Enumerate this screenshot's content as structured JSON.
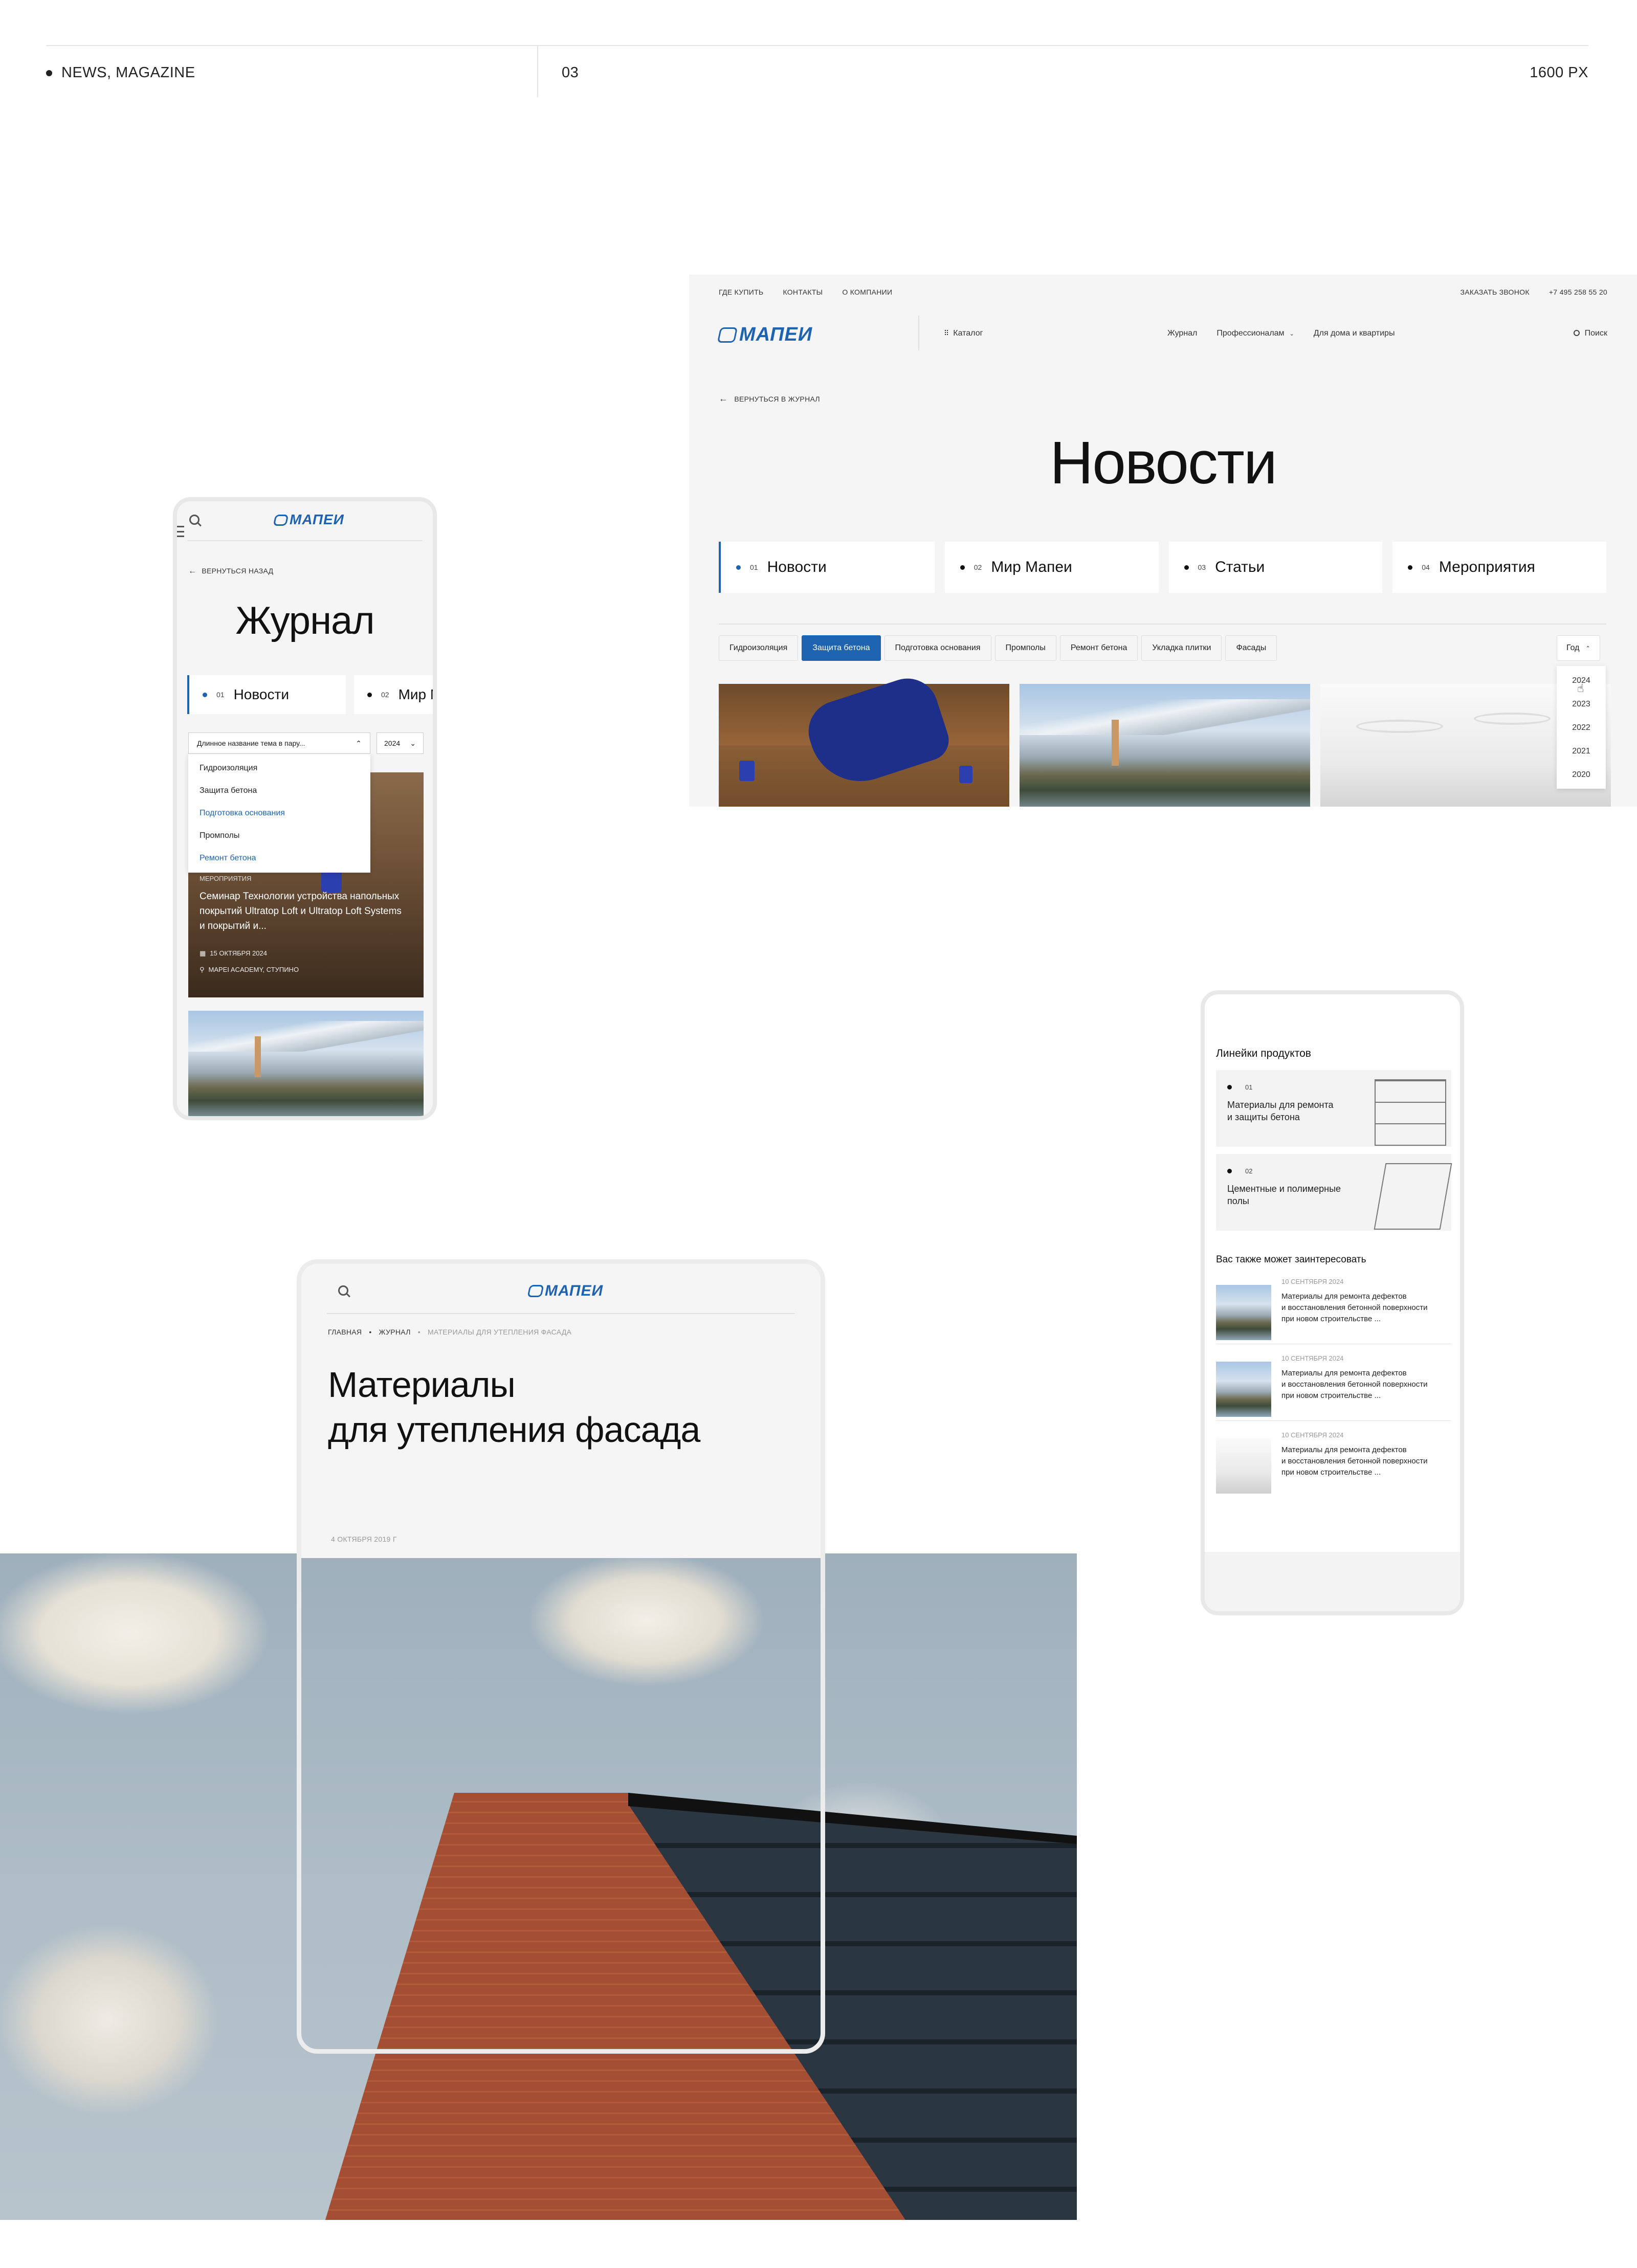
{
  "header": {
    "category": "NEWS, MAGAZINE",
    "page_no": "03",
    "width_label": "1600 PX"
  },
  "brand": {
    "logo": "МАПЕИ",
    "accent": "#1e63b0"
  },
  "desktop": {
    "utility_left": [
      "ГДЕ КУПИТЬ",
      "КОНТАКТЫ",
      "О КОМПАНИИ"
    ],
    "utility_right": [
      "ЗАКАЗАТЬ ЗВОНОК",
      "+7 495 258 55 20"
    ],
    "catalog": "Каталог",
    "nav": [
      "Журнал",
      "Профессионалам",
      "Для дома и квартиры"
    ],
    "search": "Поиск",
    "back": "ВЕРНУТЬСЯ В ЖУРНАЛ",
    "title": "Новости",
    "tabs": [
      {
        "num": "01",
        "label": "Новости"
      },
      {
        "num": "02",
        "label": "Мир Мапеи"
      },
      {
        "num": "03",
        "label": "Статьи"
      },
      {
        "num": "04",
        "label": "Мероприятия"
      }
    ],
    "chips": [
      "Гидроизоляция",
      "Защита бетона",
      "Подготовка основания",
      "Промполы",
      "Ремонт бетона",
      "Укладка плитки",
      "Фасады"
    ],
    "year_label": "Год",
    "years": [
      "2024",
      "2023",
      "2022",
      "2021",
      "2020"
    ]
  },
  "phone1": {
    "back": "ВЕРНУТЬСЯ НАЗАД",
    "title": "Журнал",
    "tab1": {
      "num": "01",
      "label": "Новости"
    },
    "tab2": {
      "num": "02",
      "label": "Мир Мапеи"
    },
    "select_value": "Длинное название тема в пару...",
    "year_value": "2024",
    "options": [
      "Гидроизоляция",
      "Защита бетона",
      "Подготовка основания",
      "Промполы",
      "Ремонт бетона"
    ],
    "card": {
      "tag": "МЕРОПРИЯТИЯ",
      "title": "Семинар Технологии устройства напольных покрытий Ultratop Loft и Ultratop Loft Systems и покрытий и...",
      "date": "15 ОКТЯБРЯ 2024",
      "place": "MAPEI ACADEMY, СТУПИНО"
    }
  },
  "phone3": {
    "breadcrumb": [
      "ГЛАВНАЯ",
      "ЖУРНАЛ",
      "МАТЕРИАЛЫ ДЛЯ УТЕПЛЕНИЯ ФАСАДА"
    ],
    "title_line1": "Материалы",
    "title_line2": "для утепления фасада",
    "date": "4 ОКТЯБРЯ 2019 Г"
  },
  "phone2": {
    "section_title": "Линейки продуктов",
    "products": [
      {
        "num": "01",
        "line1": "Материалы для ремонта",
        "line2": "и защиты бетона"
      },
      {
        "num": "02",
        "line1": "Цементные и полимерные",
        "line2": "полы"
      }
    ],
    "related_title": "Вас также может заинтересовать",
    "related": [
      {
        "date": "10 СЕНТЯБРЯ 2024",
        "l1": "Материалы для ремонта дефектов",
        "l2": "и восстановления бетонной поверхности",
        "l3": "при новом строительстве ..."
      },
      {
        "date": "10 СЕНТЯБРЯ 2024",
        "l1": "Материалы для ремонта дефектов",
        "l2": "и восстановления бетонной поверхности",
        "l3": "при новом строительстве ..."
      },
      {
        "date": "10 СЕНТЯБРЯ 2024",
        "l1": "Материалы для ремонта дефектов",
        "l2": "и восстановления бетонной поверхности",
        "l3": "при новом строительстве ..."
      }
    ]
  }
}
